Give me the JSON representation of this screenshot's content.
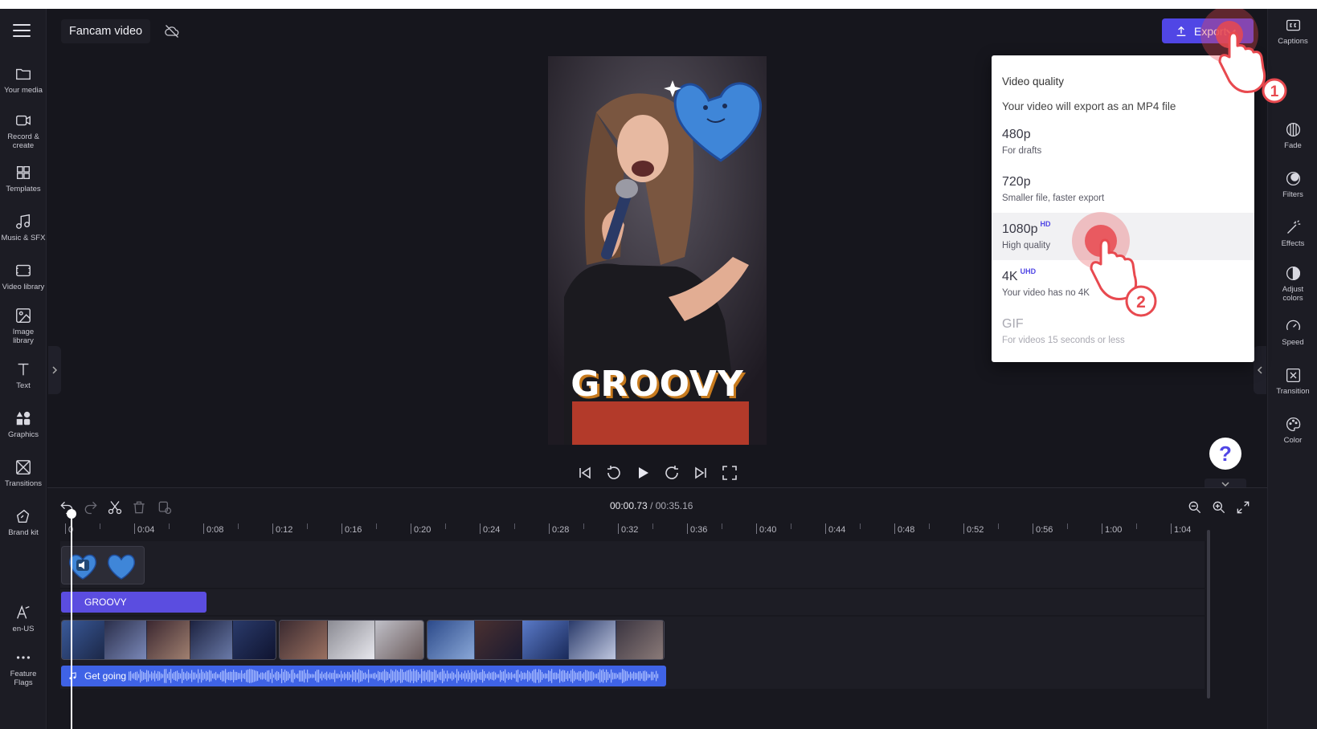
{
  "header": {
    "project_title": "Fancam video",
    "export_label": "Export"
  },
  "left_rail": [
    {
      "label": "Your media"
    },
    {
      "label": "Record &\ncreate"
    },
    {
      "label": "Templates"
    },
    {
      "label": "Music & SFX"
    },
    {
      "label": "Video library"
    },
    {
      "label": "Image\nlibrary"
    },
    {
      "label": "Text"
    },
    {
      "label": "Graphics"
    },
    {
      "label": "Transitions"
    },
    {
      "label": "Brand kit"
    },
    {
      "label": "en-US"
    },
    {
      "label": "Feature\nFlags"
    }
  ],
  "right_rail": [
    {
      "label": "Captions"
    },
    {
      "label": "Fade"
    },
    {
      "label": "Filters"
    },
    {
      "label": "Effects"
    },
    {
      "label": "Adjust\ncolors"
    },
    {
      "label": "Speed"
    },
    {
      "label": "Transition"
    },
    {
      "label": "Color"
    }
  ],
  "preview": {
    "overlay_text": "GROOVY"
  },
  "quality_menu": {
    "title": "Video quality",
    "subtitle": "Your video will export as an MP4 file",
    "options": [
      {
        "name": "480p",
        "badge": "",
        "desc": "For drafts",
        "selected": false,
        "disabled": false
      },
      {
        "name": "720p",
        "badge": "",
        "desc": "Smaller file, faster export",
        "selected": false,
        "disabled": false
      },
      {
        "name": "1080p",
        "badge": "HD",
        "desc": "High quality",
        "selected": true,
        "disabled": false
      },
      {
        "name": "4K",
        "badge": "UHD",
        "desc": "Your video has no 4K",
        "selected": false,
        "disabled": false
      },
      {
        "name": "GIF",
        "badge": "",
        "desc": "For videos 15 seconds or less",
        "selected": false,
        "disabled": true
      }
    ]
  },
  "callouts": {
    "step1": "1",
    "step2": "2"
  },
  "help_label": "?",
  "timeline": {
    "current_time": "00:00.73",
    "total_time": "/ 00:35.16",
    "ruler": [
      "0",
      "0:04",
      "0:08",
      "0:12",
      "0:16",
      "0:20",
      "0:24",
      "0:28",
      "0:32",
      "0:36",
      "0:40",
      "0:44",
      "0:48",
      "0:52",
      "0:56",
      "1:00",
      "1:04"
    ],
    "text_clip_label": "GROOVY",
    "audio_clip_label": "Get going"
  },
  "colors": {
    "accent": "#5046e5",
    "background": "#16161d",
    "audio_clip": "#3f63e6",
    "text_clip": "#5b4de0",
    "callout": "#e8494f"
  }
}
